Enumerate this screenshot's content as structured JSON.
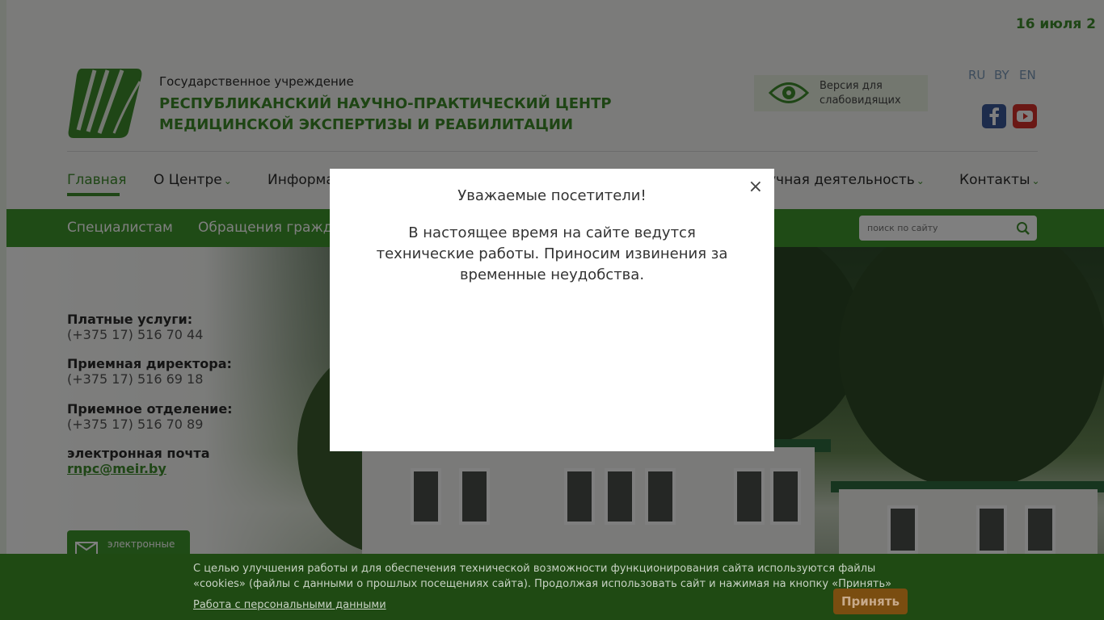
{
  "header": {
    "date": "16 июля 2",
    "org_type": "Государственное учреждение",
    "org_name_line1": "РЕСПУБЛИКАНСКИЙ НАУЧНО-ПРАКТИЧЕСКИЙ ЦЕНТР",
    "org_name_line2": "МЕДИЦИНСКОЙ ЭКСПЕРТИЗЫ И РЕАБИЛИТАЦИИ",
    "vision_line1": "Версия для",
    "vision_line2": "слабовидящих",
    "languages": [
      "RU",
      "BY",
      "EN"
    ]
  },
  "main_nav": [
    {
      "label": "Главная",
      "active": true
    },
    {
      "label": "О Центре",
      "chevron": "⌄"
    },
    {
      "label": "Информа"
    },
    {
      "label": "учная деятельность",
      "chevron": "⌄"
    },
    {
      "label": "Контакты",
      "chevron": "⌄"
    }
  ],
  "sub_nav": [
    "Специалистам",
    "Обращения гражда"
  ],
  "search": {
    "placeholder": "поиск по сайту"
  },
  "contacts": [
    {
      "label": "Платные услуги:",
      "value": "(+375 17) 516 70 44"
    },
    {
      "label": "Приемная директора:",
      "value": "(+375 17) 516 69 18"
    },
    {
      "label": "Приемное отделение:",
      "value": "(+375 17) 516 70 89"
    },
    {
      "label": "электронная почта",
      "value": "rnpc@meir.by"
    }
  ],
  "e_appeal": {
    "label": "электронные"
  },
  "modal": {
    "title": "Уважаемые посетители!",
    "text": "В настоящее время на сайте ведутся технические работы. Приносим извинения за временные неудобства.",
    "close": "×"
  },
  "cookie": {
    "text": "С целью улучшения работы и для обеспечения технической возможности функционирования сайта используются файлы «cookies» (файлы с данными о прошлых посещениях сайта). Продолжая использовать сайт и нажимая на кнопку «Принять»",
    "link": "Работа с персональными данными",
    "accept": "Принять"
  },
  "colors": {
    "brand_green": "#3f8d2c",
    "bar_green": "#3f962c",
    "cookie_bg": "#1f4a13"
  }
}
